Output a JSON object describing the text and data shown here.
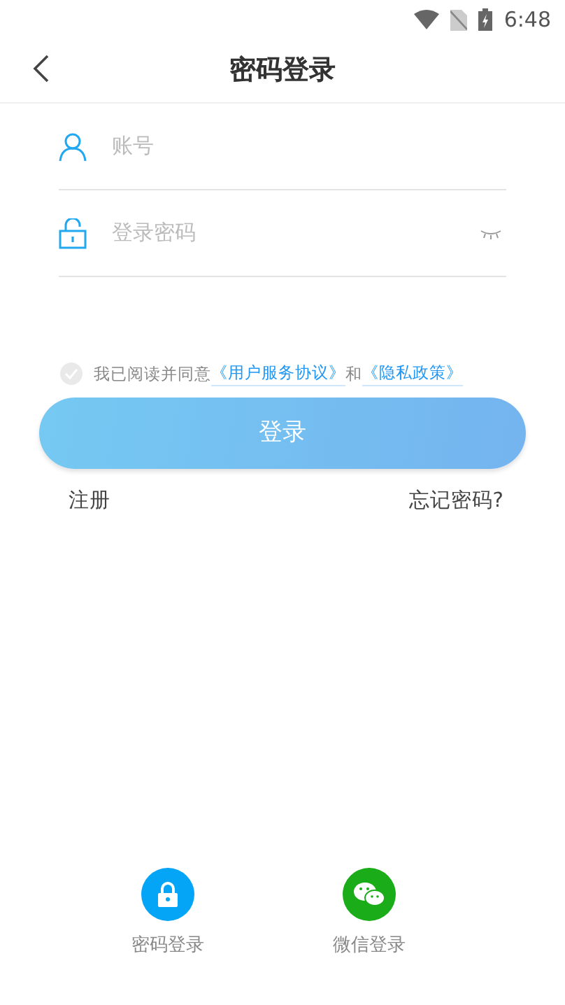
{
  "status_bar": {
    "time": "6:48"
  },
  "header": {
    "title": "密码登录"
  },
  "fields": [
    {
      "kind": "account",
      "placeholder": "账号"
    },
    {
      "kind": "password",
      "placeholder": "登录密码"
    }
  ],
  "agreement": {
    "checked": false,
    "text": "我已阅读并同意",
    "links": [
      "《用户服务协议》",
      "《隐私政策》"
    ],
    "joiner": "和"
  },
  "login_button": "登录",
  "links": {
    "register": "注册",
    "forgot": "忘记密码?"
  },
  "login_options": [
    {
      "kind": "password",
      "label": "密码登录"
    },
    {
      "kind": "wechat",
      "label": "微信登录"
    }
  ]
}
